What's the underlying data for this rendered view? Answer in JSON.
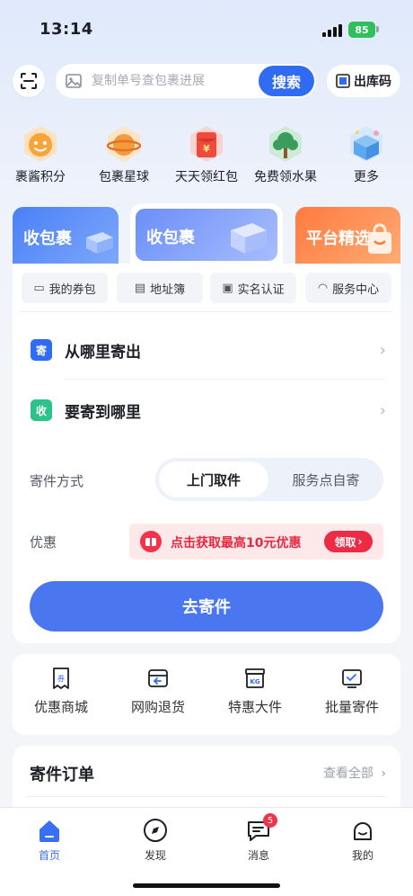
{
  "status_bar": {
    "time": "13:14",
    "battery": "85"
  },
  "search": {
    "placeholder": "复制单号查包裹进展",
    "button_label": "搜索",
    "outbound_label": "出库码"
  },
  "shortcuts": [
    {
      "label": "裹酱积分",
      "icon": "mascot-face-icon",
      "color": "#f7a43a"
    },
    {
      "label": "包裹星球",
      "icon": "planet-icon",
      "color": "#f29b3a"
    },
    {
      "label": "天天领红包",
      "icon": "red-envelope-icon",
      "color": "#ef4a3c"
    },
    {
      "label": "免费领水果",
      "icon": "tree-icon",
      "color": "#3a9d5d"
    },
    {
      "label": "更多",
      "icon": "gift-box-icon",
      "color": "#5ea7f0"
    }
  ],
  "tabs": {
    "left": "收包裹",
    "middle": "收包裹",
    "right": "平台精选"
  },
  "chips": [
    {
      "label": "我的券包",
      "icon": "coupon-icon"
    },
    {
      "label": "地址簿",
      "icon": "address-book-icon"
    },
    {
      "label": "实名认证",
      "icon": "id-card-icon"
    },
    {
      "label": "服务中心",
      "icon": "headset-icon"
    }
  ],
  "sender": {
    "badge": "寄",
    "label": "从哪里寄出",
    "color": "#2f6cf3"
  },
  "receiver": {
    "badge": "收",
    "label": "要寄到哪里",
    "color": "#2cc38a"
  },
  "send_method": {
    "label": "寄件方式",
    "options": [
      "上门取件",
      "服务点自寄"
    ],
    "selected": "上门取件"
  },
  "discount": {
    "label": "优惠",
    "promo_text": "点击获取最高10元优惠",
    "claim_label": "领取"
  },
  "send_button": "去寄件",
  "services": [
    {
      "label": "优惠商城",
      "icon": "voucher-icon",
      "glyph": "券"
    },
    {
      "label": "网购退货",
      "icon": "return-box-icon",
      "glyph": ""
    },
    {
      "label": "特惠大件",
      "icon": "heavy-parcel-icon",
      "glyph": "KG"
    },
    {
      "label": "批量寄件",
      "icon": "batch-send-icon",
      "glyph": ""
    }
  ],
  "orders": {
    "title": "寄件订单",
    "view_all": "查看全部"
  },
  "nav": [
    {
      "label": "首页",
      "icon": "home-icon",
      "active": true
    },
    {
      "label": "发现",
      "icon": "compass-icon",
      "active": false
    },
    {
      "label": "消息",
      "icon": "message-icon",
      "active": false,
      "badge": "5"
    },
    {
      "label": "我的",
      "icon": "profile-icon",
      "active": false
    }
  ],
  "colors": {
    "accent": "#2f6cf3",
    "button": "#4a77f0",
    "promo_red": "#ee2b45"
  }
}
